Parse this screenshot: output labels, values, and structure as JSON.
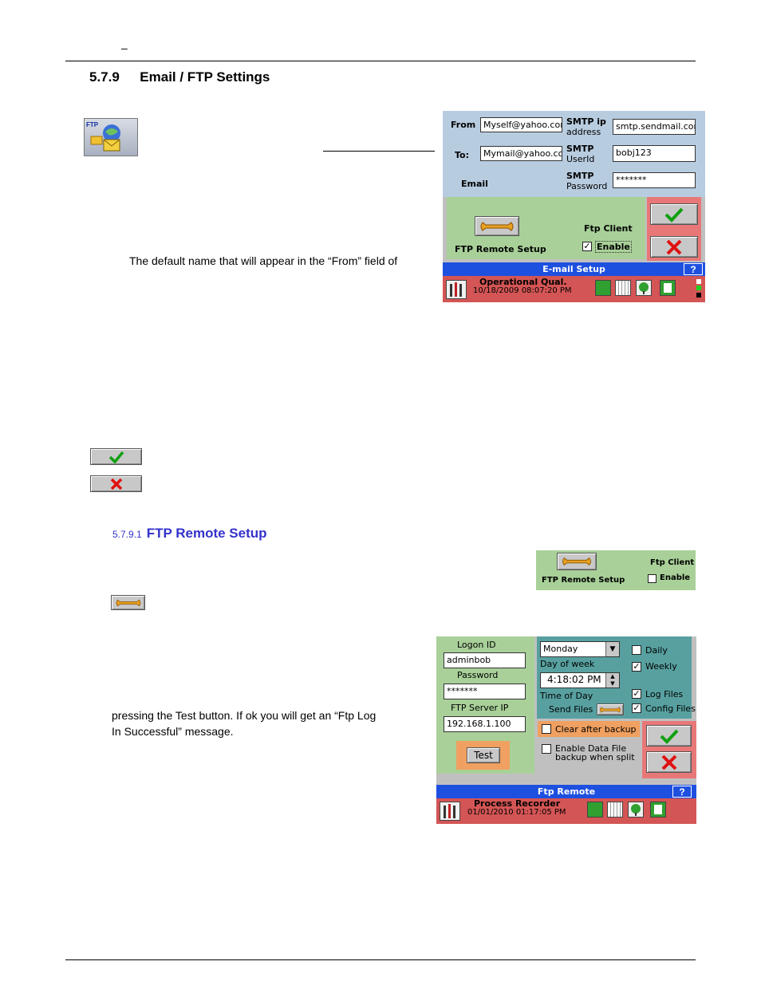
{
  "header_dash": "–",
  "section": {
    "number": "5.7.9",
    "title": "Email / FTP Settings"
  },
  "body": {
    "from_sentence": "The default name that will appear in the “From” field of"
  },
  "subsection": {
    "number": "5.7.9.1",
    "title": "FTP Remote Setup"
  },
  "ftp_text": {
    "line1": "pressing the Test button. If ok you will get an “Ftp Log",
    "line2": "In Successful” message."
  },
  "email_setup": {
    "from_label": "From",
    "from_value": "Myself@yahoo.com",
    "to_label": "To:",
    "to_value": "Mymail@yahoo.co",
    "email_label": "Email",
    "smtp_ip_label": "SMTP ip",
    "smtp_ip_sub": "address",
    "smtp_ip_value": "smtp.sendmail.com",
    "smtp_user_label": "SMTP",
    "smtp_user_sub": "UserId",
    "smtp_user_value": "bobj123",
    "smtp_pass_label": "SMTP",
    "smtp_pass_sub": "Password",
    "smtp_pass_value": "*******",
    "ftp_remote_label": "FTP Remote Setup",
    "ftp_client_label": "Ftp Client",
    "enable_label": "Enable",
    "title": "E-mail Setup",
    "help": "?",
    "status_title": "Operational Qual.",
    "status_time": "10/18/2009 08:07:20 PM"
  },
  "ftp_strip": {
    "remote_label": "FTP Remote Setup",
    "client_label": "Ftp Client",
    "enable_label": "Enable"
  },
  "ftp_remote": {
    "logon_label": "Logon ID",
    "logon_value": "adminbob",
    "password_label": "Password",
    "password_value": "*******",
    "server_label": "FTP Server IP",
    "server_value": "192.168.1.100",
    "test_label": "Test",
    "day_value": "Monday",
    "day_label": "Day of week",
    "time_value": "4:18:02 PM",
    "time_label": "Time of Day",
    "send_files_label": "Send Files",
    "daily_label": "Daily",
    "weekly_label": "Weekly",
    "log_files_label": "Log Files",
    "config_files_label": "Config Files",
    "clear_label": "Clear after backup",
    "enable_data_label1": "Enable Data File",
    "enable_data_label2": "backup when split",
    "title": "Ftp Remote",
    "help": "?",
    "status_title": "Process Recorder",
    "status_time": "01/01/2010 01:17:05 PM"
  },
  "colors": {
    "heading_blue": "#3333cc",
    "panel_blue": "#b8cce0",
    "panel_green": "#a8d098",
    "panel_red": "#e87878",
    "teal": "#58a0a0",
    "orange": "#f0a060"
  }
}
